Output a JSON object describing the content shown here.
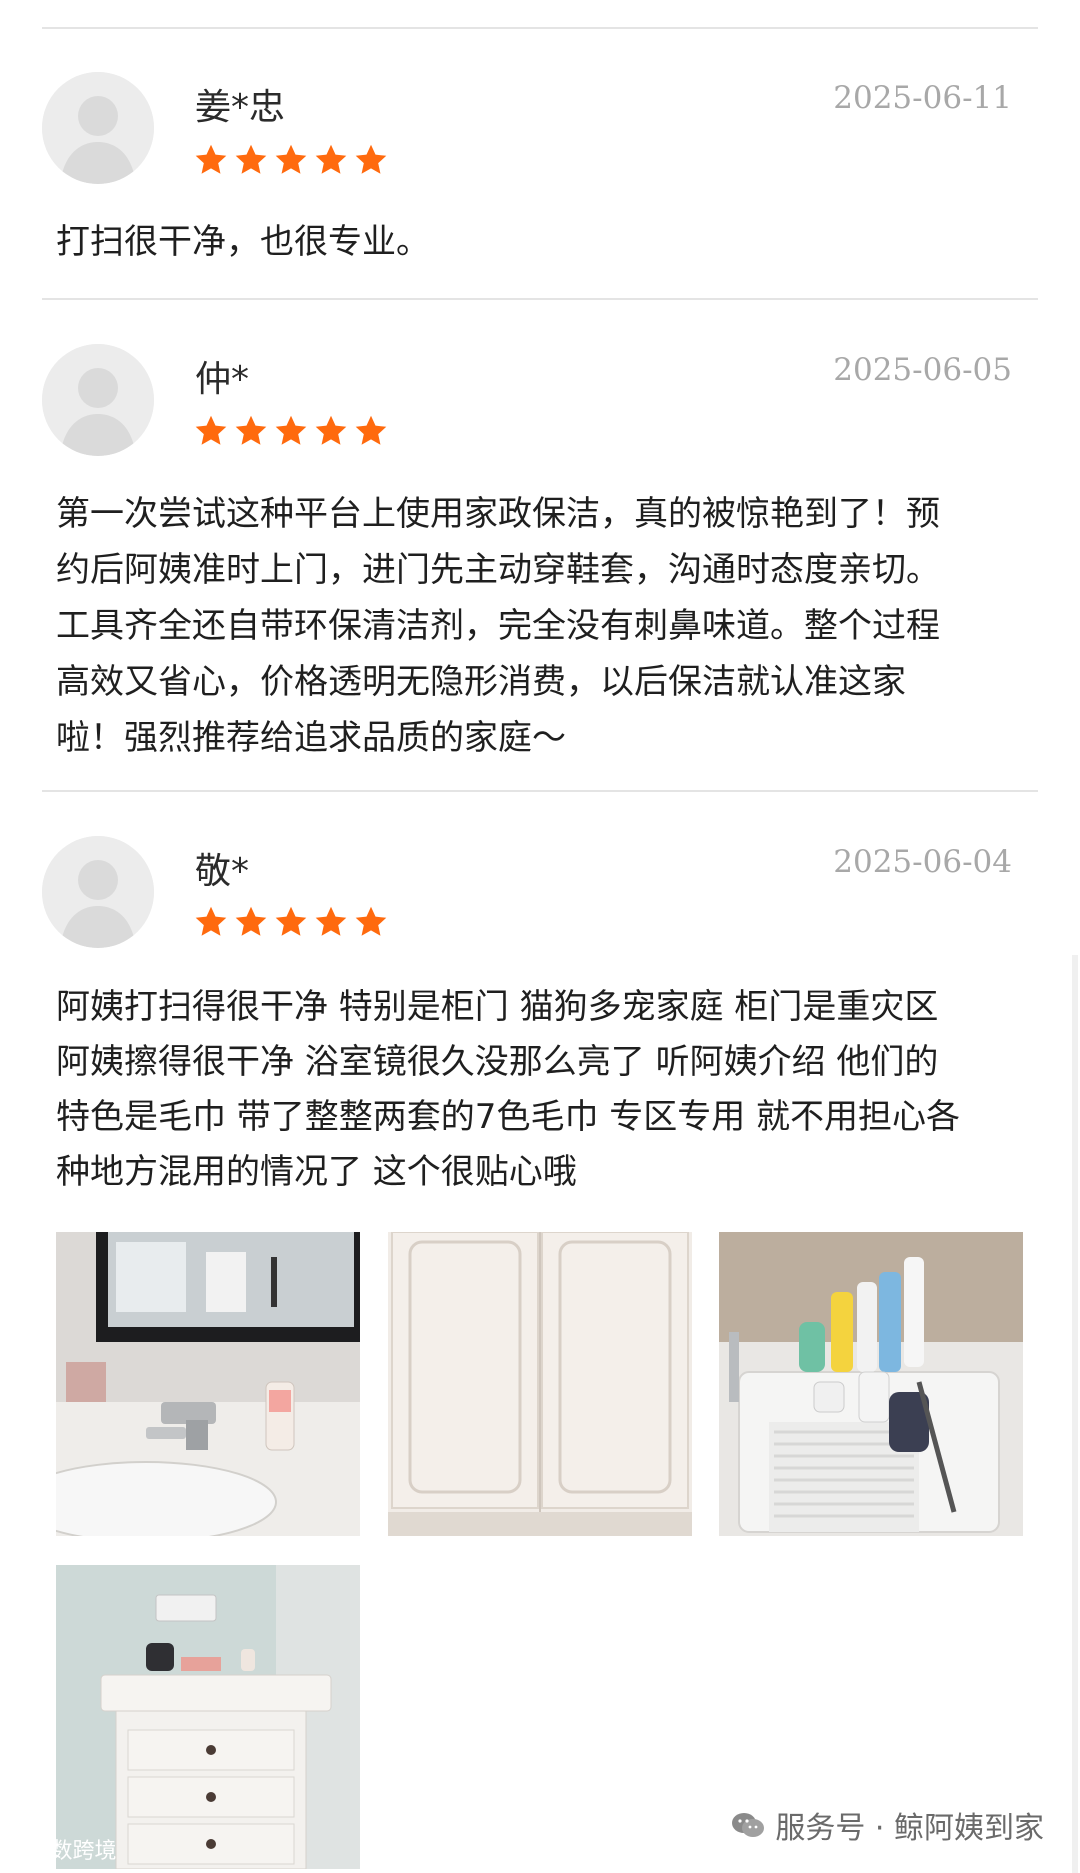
{
  "reviews": [
    {
      "name": "姜*忠",
      "date": "2025-06-11",
      "rating": 5,
      "lines": [
        "打扫很干净，也很专业。"
      ]
    },
    {
      "name": "仲*",
      "date": "2025-06-05",
      "rating": 5,
      "lines": [
        "第一次尝试这种平台上使用家政保洁，真的被惊艳到了！预",
        "约后阿姨准时上门，进门先主动穿鞋套，沟通时态度亲切。",
        "工具齐全还自带环保清洁剂，完全没有刺鼻味道。整个过程",
        "高效又省心，价格透明无隐形消费，以后保洁就认准这家",
        "啦！强烈推荐给追求品质的家庭～"
      ]
    },
    {
      "name": "敬*",
      "date": "2025-06-04",
      "rating": 5,
      "lines": [
        "阿姨打扫得很干净 特别是柜门 猫狗多宠家庭 柜门是重灾区",
        "阿姨擦得很干净 浴室镜很久没那么亮了 听阿姨介绍 他们的",
        "特色是毛巾 带了整整两套的7色毛巾 专区专用 就不用担心各",
        "种地方混用的情况了 这个很贴心哦"
      ]
    }
  ],
  "watermark": {
    "left": "大数跨境",
    "right": "服务号 · 鲸阿姨到家"
  },
  "colors": {
    "star": "#ff6a0e",
    "date": "#a8a8a8",
    "divider": "#e4e4e4"
  }
}
